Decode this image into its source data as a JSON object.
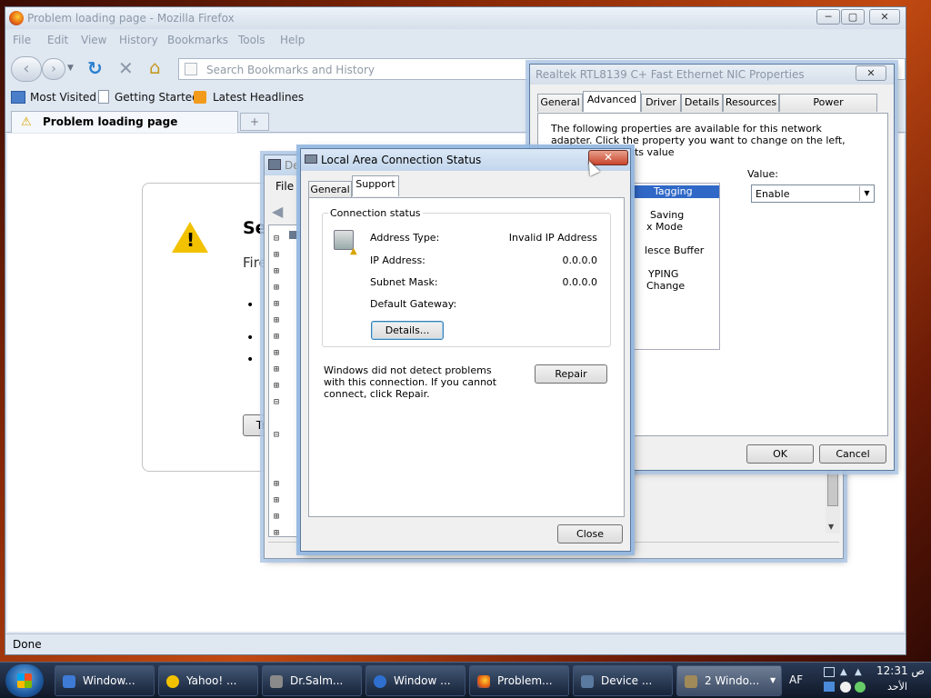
{
  "firefox": {
    "title": "Problem loading page - Mozilla Firefox",
    "menu": [
      "File",
      "Edit",
      "View",
      "History",
      "Bookmarks",
      "Tools",
      "Help"
    ],
    "search_placeholder": "Search Bookmarks and History",
    "bookmarks": [
      "Most Visited",
      "Getting Started",
      "Latest Headlines"
    ],
    "tab_title": "Problem loading page",
    "error_heading": "Se",
    "error_sub": "Fire",
    "bullets": [
      "•",
      "•",
      "•"
    ],
    "try_again": "Tr",
    "status": "Done"
  },
  "device_manager": {
    "title": "De",
    "menu_file": "File"
  },
  "nic_props": {
    "title": "Realtek RTL8139 C+ Fast Ethernet NIC Properties",
    "tabs": [
      "General",
      "Advanced",
      "Driver",
      "Details",
      "Resources",
      "Power Management"
    ],
    "description": "The following properties are available for this network adapter. Click the property you want to change on the left, and then select its value",
    "properties": [
      "Tagging",
      "Saving",
      "x Mode",
      "lesce Buffer",
      "YPING",
      "Change"
    ],
    "value_label": "Value:",
    "value": "Enable",
    "ok": "OK",
    "cancel": "Cancel"
  },
  "lac_status": {
    "title": "Local Area Connection Status",
    "tabs": [
      "General",
      "Support"
    ],
    "group_label": "Connection status",
    "rows": [
      {
        "label": "Address Type:",
        "value": "Invalid IP Address"
      },
      {
        "label": "IP Address:",
        "value": "0.0.0.0"
      },
      {
        "label": "Subnet Mask:",
        "value": "0.0.0.0"
      },
      {
        "label": "Default Gateway:",
        "value": ""
      }
    ],
    "details_button": "Details...",
    "message": "Windows did not detect problems with this connection. If you cannot connect, click Repair.",
    "repair_button": "Repair",
    "close_button": "Close"
  },
  "taskbar": {
    "items": [
      {
        "label": "Window...",
        "color": "#3d7bd6"
      },
      {
        "label": "Yahoo! ...",
        "color": "#f2c200"
      },
      {
        "label": "Dr.Salm...",
        "color": "#8a8a8a"
      },
      {
        "label": "Window ...",
        "color": "#2f6fd0"
      },
      {
        "label": "Problem...",
        "color": "#e36b14"
      },
      {
        "label": "Device ...",
        "color": "#5a7aa0"
      },
      {
        "label": "2 Windo...",
        "color": "#a08a5a"
      }
    ],
    "lang": "AF",
    "time": "12:31 ص",
    "day": "الأحد"
  }
}
